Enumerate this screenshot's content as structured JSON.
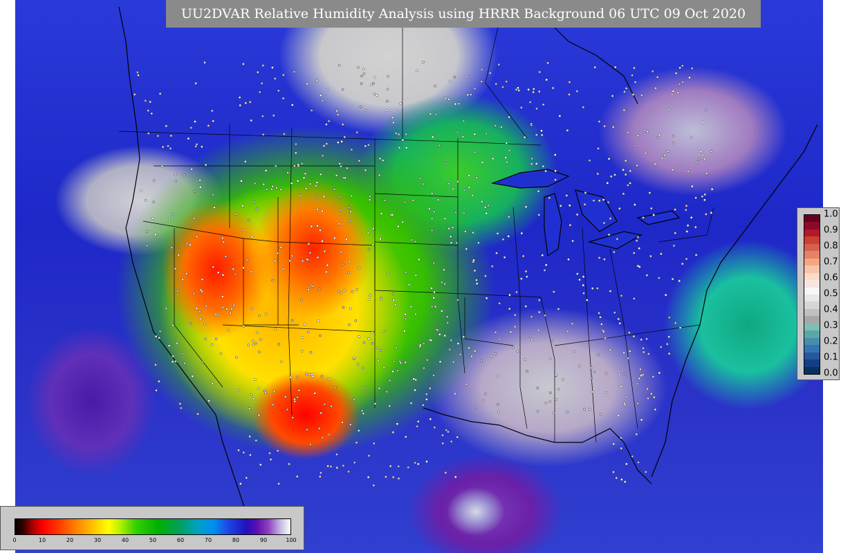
{
  "title": "UU2DVAR Relative Humidity Analysis using HRRR Background 06 UTC 09 Oct 2020",
  "rh_colorbar": {
    "ticks": [
      "0",
      "10",
      "20",
      "30",
      "40",
      "50",
      "60",
      "70",
      "80",
      "90",
      "100"
    ]
  },
  "ratio_colorbar": {
    "ticks": [
      "1.0",
      "0.9",
      "0.8",
      "0.7",
      "0.6",
      "0.5",
      "0.4",
      "0.3",
      "0.2",
      "0.1",
      "0.0"
    ],
    "colors": [
      "#67001f",
      "#8c0a26",
      "#b2182b",
      "#c8422f",
      "#d6604d",
      "#e58268",
      "#f4a582",
      "#f8c4a8",
      "#fddbc7",
      "#f5e6e0",
      "#f7f7f7",
      "#e8e8e8",
      "#d6d6d6",
      "#c0c0c0",
      "#a8a8a8",
      "#7fbfb6",
      "#5aa8a6",
      "#4a8cb0",
      "#3673b0",
      "#24589e",
      "#143f88",
      "#053061"
    ]
  }
}
